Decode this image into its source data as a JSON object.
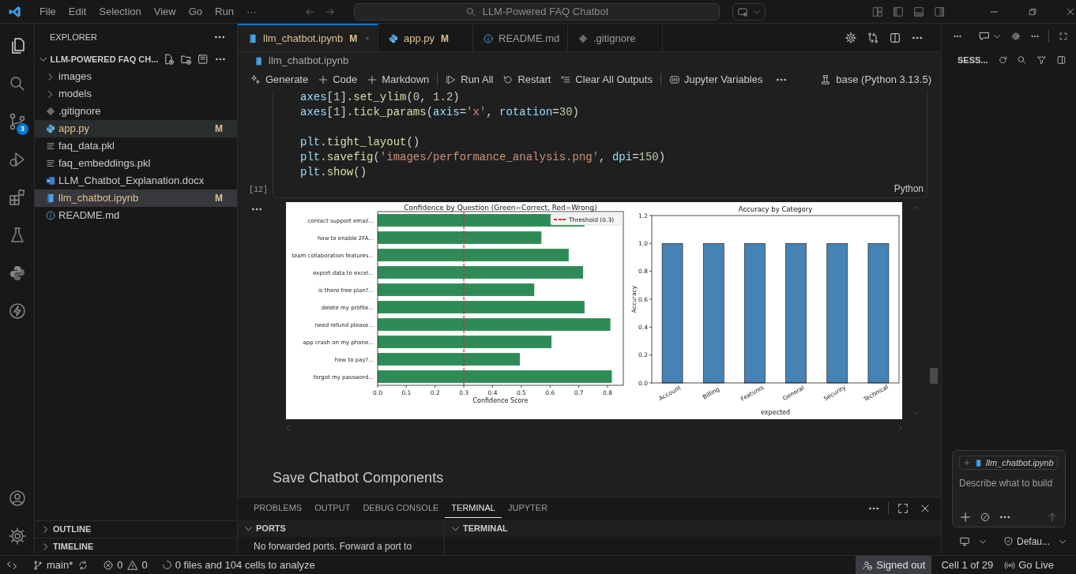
{
  "title_bar": {
    "menu": [
      "File",
      "Edit",
      "Selection",
      "View",
      "Go",
      "Run",
      "···"
    ],
    "search": "LLM-Powered FAQ Chatbot"
  },
  "activity_bar": {
    "source_control_badge": "3"
  },
  "explorer": {
    "title": "EXPLORER",
    "root": "LLM-POWERED FAQ CH...",
    "items": [
      {
        "kind": "folder",
        "label": "images",
        "modified": false,
        "selected": false,
        "hovered": false
      },
      {
        "kind": "folder",
        "label": "models",
        "modified": false,
        "selected": false,
        "hovered": false
      },
      {
        "kind": "git",
        "label": ".gitignore",
        "modified": false,
        "selected": false,
        "hovered": false
      },
      {
        "kind": "python",
        "label": "app.py",
        "modified": true,
        "status": "M",
        "selected": false,
        "hovered": true
      },
      {
        "kind": "data",
        "label": "faq_data.pkl",
        "modified": false,
        "selected": false,
        "hovered": false
      },
      {
        "kind": "data",
        "label": "faq_embeddings.pkl",
        "modified": false,
        "selected": false,
        "hovered": false
      },
      {
        "kind": "doc",
        "label": "LLM_Chatbot_Explanation.docx",
        "modified": false,
        "selected": false,
        "hovered": false
      },
      {
        "kind": "notebook",
        "label": "llm_chatbot.ipynb",
        "modified": true,
        "status": "M",
        "selected": true,
        "hovered": false
      },
      {
        "kind": "info",
        "label": "README.md",
        "modified": false,
        "selected": false,
        "hovered": false
      }
    ],
    "sections": [
      "OUTLINE",
      "TIMELINE"
    ]
  },
  "tabs": [
    {
      "kind": "notebook",
      "label": "llm_chatbot.ipynb",
      "modified": true,
      "status": "M",
      "selected": true
    },
    {
      "kind": "python",
      "label": "app.py",
      "modified": true,
      "status": "M",
      "selected": false
    },
    {
      "kind": "info",
      "label": "README.md",
      "modified": false,
      "selected": false
    },
    {
      "kind": "git",
      "label": ".gitignore",
      "modified": false,
      "selected": false
    }
  ],
  "breadcrumb": "llm_chatbot.ipynb",
  "toolbar": [
    {
      "kind": "sparkle",
      "label": "Generate"
    },
    {
      "kind": "plus",
      "label": "Code"
    },
    {
      "kind": "plus",
      "label": "Markdown"
    },
    {
      "kind": "play",
      "label": "Run All"
    },
    {
      "kind": "restart",
      "label": "Restart"
    },
    {
      "kind": "clear",
      "label": "Clear All Outputs"
    },
    {
      "kind": "variables",
      "label": "Jupyter Variables"
    }
  ],
  "kernel": "base (Python 3.13.5)",
  "cell": {
    "execution_count": "[12]",
    "language": "Python",
    "blocks": [
      {
        "lines": [
          {
            "tokens": [
              {
                "text": "axes",
                "kind": "var"
              },
              {
                "text": "[",
                "kind": "punct"
              },
              {
                "text": "1",
                "kind": "num"
              },
              {
                "text": "].",
                "kind": "punct"
              },
              {
                "text": "set_ylim",
                "kind": "func"
              },
              {
                "text": "(",
                "kind": "punct"
              },
              {
                "text": "0",
                "kind": "num"
              },
              {
                "text": ", ",
                "kind": "punct"
              },
              {
                "text": "1.2",
                "kind": "num"
              },
              {
                "text": ")",
                "kind": "punct"
              }
            ]
          },
          {
            "tokens": [
              {
                "text": "axes",
                "kind": "var"
              },
              {
                "text": "[",
                "kind": "punct"
              },
              {
                "text": "1",
                "kind": "num"
              },
              {
                "text": "].",
                "kind": "punct"
              },
              {
                "text": "tick_params",
                "kind": "func"
              },
              {
                "text": "(",
                "kind": "punct"
              },
              {
                "text": "axis",
                "kind": "var"
              },
              {
                "text": "=",
                "kind": "punct"
              },
              {
                "text": "'x'",
                "kind": "str"
              },
              {
                "text": ", ",
                "kind": "punct"
              },
              {
                "text": "rotation",
                "kind": "var"
              },
              {
                "text": "=",
                "kind": "punct"
              },
              {
                "text": "30",
                "kind": "num"
              },
              {
                "text": ")",
                "kind": "punct"
              }
            ]
          }
        ]
      },
      {
        "lines": [
          {
            "tokens": [
              {
                "text": "plt",
                "kind": "var"
              },
              {
                "text": ".",
                "kind": "punct"
              },
              {
                "text": "tight_layout",
                "kind": "func"
              },
              {
                "text": "()",
                "kind": "punct"
              }
            ]
          },
          {
            "tokens": [
              {
                "text": "plt",
                "kind": "var"
              },
              {
                "text": ".",
                "kind": "punct"
              },
              {
                "text": "savefig",
                "kind": "func"
              },
              {
                "text": "(",
                "kind": "punct"
              },
              {
                "text": "'images/performance_analysis.png'",
                "kind": "str"
              },
              {
                "text": ", ",
                "kind": "punct"
              },
              {
                "text": "dpi",
                "kind": "var"
              },
              {
                "text": "=",
                "kind": "punct"
              },
              {
                "text": "150",
                "kind": "num"
              },
              {
                "text": ")",
                "kind": "punct"
              }
            ]
          },
          {
            "tokens": [
              {
                "text": "plt",
                "kind": "var"
              },
              {
                "text": ".",
                "kind": "punct"
              },
              {
                "text": "show",
                "kind": "func"
              },
              {
                "text": "()",
                "kind": "punct"
              }
            ]
          }
        ]
      }
    ]
  },
  "output": {
    "charts": [
      {
        "chart_data": {
          "type": "bar",
          "orientation": "horizontal",
          "title": "Confidence by Question (Green=Correct, Red=Wrong)",
          "xlabel": "Confidence Score",
          "categories": [
            "contact support email...",
            "how to enable 2FA...",
            "team collaboration features...",
            "export data to excel...",
            "is there free plan?...",
            "delete my profile...",
            "need refund please...",
            "app crash on my phone...",
            "how to pay?...",
            "forgot my password..."
          ],
          "series": [
            {
              "color": "#2e8b57",
              "values": [
                0.72,
                0.57,
                0.665,
                0.715,
                0.545,
                0.72,
                0.81,
                0.605,
                0.495,
                0.815
              ]
            }
          ],
          "xlim": [
            0,
            0.855
          ],
          "xticks": [
            {
              "value": 0,
              "label": "0.0"
            },
            {
              "value": 0.1,
              "label": "0.1"
            },
            {
              "value": 0.2,
              "label": "0.2"
            },
            {
              "value": 0.3,
              "label": "0.3"
            },
            {
              "value": 0.4,
              "label": "0.4"
            },
            {
              "value": 0.5,
              "label": "0.5"
            },
            {
              "value": 0.6,
              "label": "0.6"
            },
            {
              "value": 0.7,
              "label": "0.7"
            },
            {
              "value": 0.8,
              "label": "0.8"
            }
          ],
          "ref_lines": [
            {
              "axis": "x",
              "value": 0.3,
              "color": "#d62728"
            }
          ],
          "annotations": [
            {
              "text": "Threshold (0.3)"
            }
          ]
        }
      },
      {
        "chart_data": {
          "type": "bar",
          "title": "Accuracy by Category",
          "xlabel": "expected",
          "ylabel": "Accuracy",
          "categories": [
            "Account",
            "Billing",
            "Features",
            "General",
            "Security",
            "Technical"
          ],
          "series": [
            {
              "color": "#4682b4",
              "values": [
                1,
                1,
                1,
                1,
                1,
                1
              ]
            }
          ],
          "ylim": [
            0,
            1.2
          ],
          "yticks": [
            {
              "value": 0,
              "label": "0.0"
            },
            {
              "value": 0.2,
              "label": "0.2"
            },
            {
              "value": 0.4,
              "label": "0.4"
            },
            {
              "value": 0.6,
              "label": "0.6"
            },
            {
              "value": 0.8,
              "label": "0.8"
            },
            {
              "value": 1,
              "label": "1.0"
            },
            {
              "value": 1.2,
              "label": "1.2"
            }
          ]
        }
      }
    ]
  },
  "markdown_heading": "Save Chatbot Components",
  "panel": {
    "tabs": [
      {
        "label": "PROBLEMS",
        "selected": false
      },
      {
        "label": "OUTPUT",
        "selected": false
      },
      {
        "label": "DEBUG CONSOLE",
        "selected": false
      },
      {
        "label": "TERMINAL",
        "selected": true
      },
      {
        "label": "JUPYTER",
        "selected": false
      }
    ],
    "sections": [
      {
        "label": "PORTS",
        "text": "No forwarded ports. Forward a port to"
      },
      {
        "label": "TERMINAL"
      }
    ]
  },
  "chat": {
    "header": "SESS...",
    "attachment": "llm_chatbot.ipynb",
    "placeholder": "Describe what to build",
    "mode": "Defau..."
  },
  "status_bar": {
    "branch": "main*",
    "errors": "0",
    "warnings": "0",
    "analysis": "0 files and 104 cells to analyze",
    "account": "Signed out",
    "cell": "Cell 1 of 29",
    "live": "Go Live"
  }
}
